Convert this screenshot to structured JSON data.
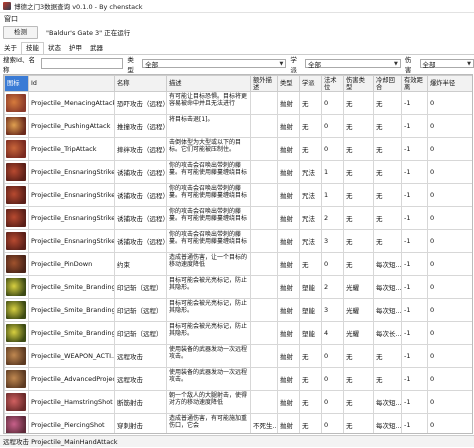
{
  "window": {
    "title": "博德之门3数据查询 v0.1.0 - By chenstack"
  },
  "menu": {
    "items": [
      "窗口"
    ]
  },
  "toolbar": {
    "detect_label": "检测",
    "status": "\"Baldur's Gate 3\" 正在运行"
  },
  "tabs": [
    "关于",
    "技能",
    "状态",
    "护甲",
    "武器"
  ],
  "filters": {
    "search_label": "搜索Id、名称",
    "type_label": "类型",
    "type_value": "全部",
    "school_label": "学派",
    "school_value": "全部",
    "damage_label": "伤害",
    "damage_value": "全部"
  },
  "table": {
    "columns": [
      "图标",
      "Id",
      "名称",
      "描述",
      "额外描述",
      "类型",
      "学派",
      "法术位",
      "伤害类型",
      "冷却回合",
      "有效距离",
      "爆炸半径"
    ],
    "rows": [
      {
        "id": "Projectile_MenacingAttack",
        "name": "恐吓攻击（远程）",
        "desc": "有可能让目标恐惧。目标将更容易被命中并且无法进行",
        "extra": "",
        "type": "抛射",
        "school": "无",
        "slot": "0",
        "dmg": "无",
        "cd": "无",
        "range": "-1",
        "radius": "0",
        "c1": "#8a3a2a",
        "c2": "#d67b3c"
      },
      {
        "id": "Projectile_PushingAttack",
        "name": "推撞攻击（远程）",
        "desc": "将目标击退[1]。",
        "extra": "",
        "type": "抛射",
        "school": "无",
        "slot": "0",
        "dmg": "无",
        "cd": "无",
        "range": "-1",
        "radius": "0",
        "c1": "#6b2b1c",
        "c2": "#e0a050"
      },
      {
        "id": "Projectile_TripAttack",
        "name": "摔绊攻击（远程）",
        "desc": "击倒体型为大型或以下的目标。它们可能被压制住。",
        "extra": "",
        "type": "抛射",
        "school": "无",
        "slot": "0",
        "dmg": "无",
        "cd": "无",
        "range": "-1",
        "radius": "0",
        "c1": "#7a2a20",
        "c2": "#c9663a"
      },
      {
        "id": "Projectile_EnsnaringStrike",
        "name": "诱捕攻击（远程）",
        "desc": "你的攻击会召唤出带刺的藤蔓。有可能使用藤蔓缠绕目标",
        "extra": "",
        "type": "抛射",
        "school": "咒法",
        "slot": "1",
        "dmg": "无",
        "cd": "无",
        "range": "-1",
        "radius": "0",
        "c1": "#5a1f18",
        "c2": "#b84a30"
      },
      {
        "id": "Projectile_EnsnaringStrike_...",
        "name": "诱捕攻击（远程）",
        "desc": "你的攻击会召唤出带刺的藤蔓。有可能使用藤蔓缠绕目标",
        "extra": "",
        "type": "抛射",
        "school": "咒法",
        "slot": "1",
        "dmg": "无",
        "cd": "无",
        "range": "-1",
        "radius": "0",
        "c1": "#5a1f18",
        "c2": "#b84a30"
      },
      {
        "id": "Projectile_EnsnaringStrike_2",
        "name": "诱捕攻击（远程）",
        "desc": "你的攻击会召唤出带刺的藤蔓。有可能使用藤蔓缠绕目标",
        "extra": "",
        "type": "抛射",
        "school": "咒法",
        "slot": "2",
        "dmg": "无",
        "cd": "无",
        "range": "-1",
        "radius": "0",
        "c1": "#5a1f18",
        "c2": "#b84a30"
      },
      {
        "id": "Projectile_EnsnaringStrike_3",
        "name": "诱捕攻击（远程）",
        "desc": "你的攻击会召唤出带刺的藤蔓。有可能使用藤蔓缠绕目标",
        "extra": "",
        "type": "抛射",
        "school": "咒法",
        "slot": "3",
        "dmg": "无",
        "cd": "无",
        "range": "-1",
        "radius": "0",
        "c1": "#5a1f18",
        "c2": "#b84a30"
      },
      {
        "id": "Projectile_PinDown",
        "name": "约束",
        "desc": "造成普通伤害，让一个目标的移动速度降低",
        "extra": "",
        "type": "抛射",
        "school": "无",
        "slot": "0",
        "dmg": "无",
        "cd": "每次短...",
        "range": "-1",
        "radius": "0",
        "c1": "#4a2418",
        "c2": "#a0522d"
      },
      {
        "id": "Projectile_Smite_Branding",
        "name": "印记斩（远程）",
        "desc": "目标可能会被光亮标记，防止其隐形。",
        "extra": "",
        "type": "抛射",
        "school": "塑能",
        "slot": "2",
        "dmg": "光耀",
        "cd": "每次短...",
        "range": "-1",
        "radius": "0",
        "c1": "#3d4a14",
        "c2": "#d8d040"
      },
      {
        "id": "Projectile_Smite_Branding_3",
        "name": "印记斩（远程）",
        "desc": "目标可能会被光亮标记，防止其隐形。",
        "extra": "",
        "type": "抛射",
        "school": "塑能",
        "slot": "3",
        "dmg": "光耀",
        "cd": "每次短...",
        "range": "-1",
        "radius": "0",
        "c1": "#3d4a14",
        "c2": "#d8d040"
      },
      {
        "id": "Projectile_Smite_Branding_...",
        "name": "印记斩（远程）",
        "desc": "目标可能会被光亮标记，防止其隐形。",
        "extra": "",
        "type": "抛射",
        "school": "塑能",
        "slot": "4",
        "dmg": "光耀",
        "cd": "每次长...",
        "range": "-1",
        "radius": "0",
        "c1": "#3d4a14",
        "c2": "#d8d040"
      },
      {
        "id": "Projectile_WEAPON_ACTI...",
        "name": "远程攻击",
        "desc": "使用装备的武器发动一次远程攻击。",
        "extra": "",
        "type": "抛射",
        "school": "无",
        "slot": "0",
        "dmg": "无",
        "cd": "无",
        "range": "-1",
        "radius": "0",
        "c1": "#5c3a22",
        "c2": "#c08850"
      },
      {
        "id": "Projectile_AdvancedProjec...",
        "name": "远程攻击",
        "desc": "使用装备的武器发动一次远程攻击。",
        "extra": "",
        "type": "抛射",
        "school": "无",
        "slot": "0",
        "dmg": "无",
        "cd": "无",
        "range": "-1",
        "radius": "0",
        "c1": "#5c3a22",
        "c2": "#c08850"
      },
      {
        "id": "Projectile_HamstringShot",
        "name": "断筋射击",
        "desc": "朝一个敌人的大腿射击，使得对方的移动速度降低",
        "extra": "",
        "type": "抛射",
        "school": "无",
        "slot": "0",
        "dmg": "无",
        "cd": "每次短...",
        "range": "-1",
        "radius": "0",
        "c1": "#6a2a2a",
        "c2": "#d06060"
      },
      {
        "id": "Projectile_PiercingShot",
        "name": "穿刺射击",
        "desc": "造成普通伤害，有可能施加重伤口，它会",
        "extra": "不死生...",
        "type": "抛射",
        "school": "无",
        "slot": "0",
        "dmg": "无",
        "cd": "每次短...",
        "range": "-1",
        "radius": "0",
        "c1": "#5e2a3a",
        "c2": "#c8608a"
      },
      {
        "id": "Projectile_MobileShooting",
        "name": "移动射击",
        "desc": "本回合使用远程攻击时不会",
        "extra": "",
        "type": "抛射",
        "school": "无",
        "slot": "0",
        "dmg": "无",
        "cd": "每次短...",
        "range": "-1",
        "radius": "0",
        "c1": "#4a3020",
        "c2": "#b08a60"
      }
    ]
  },
  "statusbar": {
    "text": "远程攻击 Projectile_MainHandAttack"
  }
}
